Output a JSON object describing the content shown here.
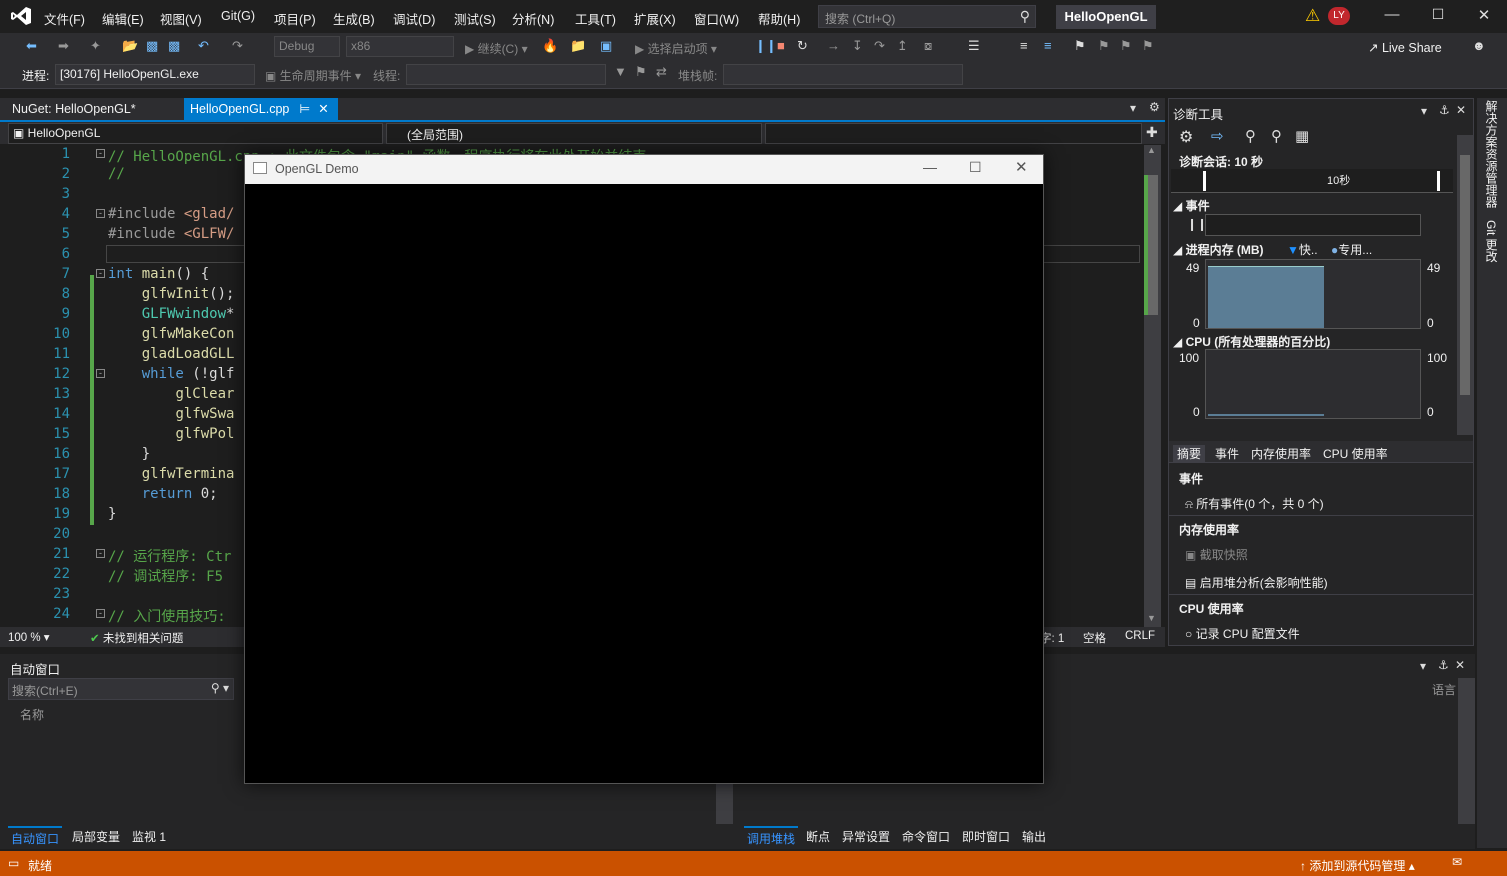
{
  "menu": [
    "文件(F)",
    "编辑(E)",
    "视图(V)",
    "Git(G)",
    "项目(P)",
    "生成(B)",
    "调试(D)",
    "测试(S)",
    "分析(N)",
    "工具(T)",
    "扩展(X)",
    "窗口(W)",
    "帮助(H)"
  ],
  "search": {
    "placeholder": "搜索 (Ctrl+Q)"
  },
  "app_title": "HelloOpenGL",
  "user_initials": "LY",
  "toolbar": {
    "config": "Debug",
    "platform": "x86",
    "continue": "继续(C)",
    "startup": "选择启动项",
    "live_share": "Live Share"
  },
  "toolbar2": {
    "process_label": "进程:",
    "process_value": "[30176] HelloOpenGL.exe",
    "lifecycle": "生命周期事件",
    "thread": "线程:",
    "stackframe": "堆栈帧:"
  },
  "tabs": [
    {
      "label": "NuGet: HelloOpenGL*"
    },
    {
      "label": "HelloOpenGL.cpp"
    }
  ],
  "navbar": {
    "project": "HelloOpenGL",
    "scope": "(全局范围)"
  },
  "code_lines": [
    {
      "n": "1",
      "t": "// HelloOpenGL.cpp : 此文件包含 \"main\" 函数。程序执行将在此处开始并结束。"
    },
    {
      "n": "2",
      "t": "//"
    },
    {
      "n": "3",
      "t": ""
    },
    {
      "n": "4",
      "t": "#include <glad/"
    },
    {
      "n": "5",
      "t": "#include <GLFW/"
    },
    {
      "n": "6",
      "t": ""
    },
    {
      "n": "7",
      "t": "int main() {"
    },
    {
      "n": "8",
      "t": "    glfwInit();"
    },
    {
      "n": "9",
      "t": "    GLFWwindow*"
    },
    {
      "n": "10",
      "t": "    glfwMakeCon"
    },
    {
      "n": "11",
      "t": "    gladLoadGLL"
    },
    {
      "n": "12",
      "t": "    while (!glf"
    },
    {
      "n": "13",
      "t": "        glClear"
    },
    {
      "n": "14",
      "t": "        glfwSwa"
    },
    {
      "n": "15",
      "t": "        glfwPol"
    },
    {
      "n": "16",
      "t": "    }"
    },
    {
      "n": "17",
      "t": "    glfwTermina"
    },
    {
      "n": "18",
      "t": "    return 0;"
    },
    {
      "n": "19",
      "t": "}"
    },
    {
      "n": "20",
      "t": ""
    },
    {
      "n": "21",
      "t": "// 运行程序: Ctr"
    },
    {
      "n": "22",
      "t": "// 调试程序: F5"
    },
    {
      "n": "23",
      "t": ""
    },
    {
      "n": "24",
      "t": "// 入门使用技巧:"
    }
  ],
  "editor_status": {
    "zoom": "100 %",
    "issues": "未找到相关问题",
    "col": "字: 1",
    "spaces": "空格",
    "eol": "CRLF"
  },
  "diag": {
    "title": "诊断工具",
    "session": "诊断会话: 10 秒",
    "timeline_label": "10秒",
    "events": "事件",
    "memory_title": "进程内存 (MB)",
    "legend_snapshot": "快..",
    "legend_private": "专用...",
    "mem_max": "49",
    "mem_min": "0",
    "cpu_title": "CPU (所有处理器的百分比)",
    "cpu_max": "100",
    "cpu_min": "0",
    "tabs": [
      "摘要",
      "事件",
      "内存使用率",
      "CPU 使用率"
    ],
    "sec_events": "事件",
    "all_events": "所有事件(0 个，共 0 个)",
    "sec_memory": "内存使用率",
    "snapshot": "截取快照",
    "heap": "启用堆分析(会影响性能)",
    "sec_cpu": "CPU 使用率",
    "cpu_profile": "记录 CPU 配置文件"
  },
  "auto_window": {
    "title": "自动窗口",
    "search_placeholder": "搜索(Ctrl+E)",
    "col_name": "名称",
    "tabs": [
      "自动窗口",
      "局部变量",
      "监视 1"
    ]
  },
  "callstack": {
    "col_lang": "语言",
    "tabs": [
      "调用堆栈",
      "断点",
      "异常设置",
      "命令窗口",
      "即时窗口",
      "输出"
    ]
  },
  "side_tabs": [
    "解决方案资源管理器",
    "Git 更改"
  ],
  "status": {
    "ready": "就绪",
    "source_control": "添加到源代码管理"
  },
  "opengl_window": {
    "title": "OpenGL Demo"
  },
  "colors": {
    "accent": "#007acc",
    "status_bar": "#ca5100"
  }
}
